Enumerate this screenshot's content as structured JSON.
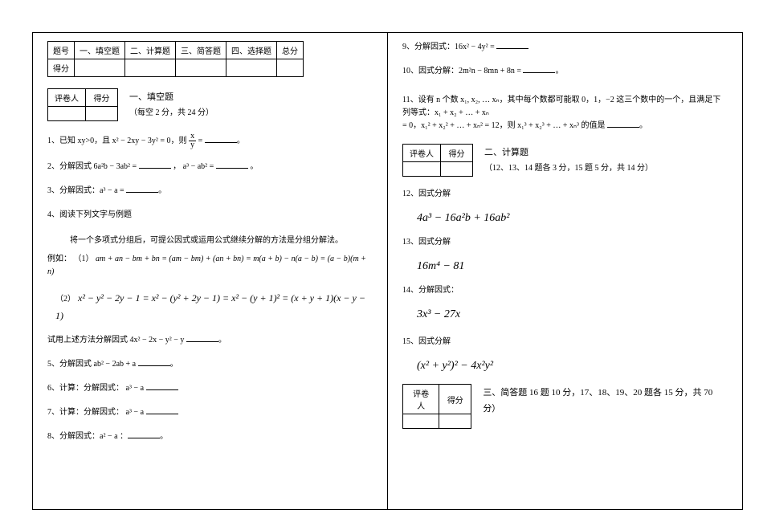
{
  "scoring": {
    "header": [
      "题号",
      "一、填空题",
      "二、计算题",
      "三、简答题",
      "四、选择题",
      "总分"
    ],
    "row_label": "得分",
    "mini_headers": [
      "评卷人",
      "得分"
    ]
  },
  "sections": {
    "fill": {
      "title": "一、填空题",
      "sub": "（每空 2 分，共 24 分）"
    },
    "calc": {
      "title": "二、计算题",
      "sub": "（12、13、14 题各 3 分，15 题 5 分，共 14 分）"
    },
    "ans": {
      "title": "三、简答题 16 题 10 分，17、18、19、20 题各 15 分，共 70 分）"
    }
  },
  "q1": {
    "pre": "1、已知 xy>0，且 x² − 2xy − 3y² = 0，则 ",
    "frac_top": "x",
    "frac_bot": "y",
    "post": " = "
  },
  "q2": {
    "pre": "2、分解因式 6a²b − 3ab² = ",
    "mid": "，  a³ − ab² = ",
    "post": "。"
  },
  "q3": "3、分解因式：a³ − a = ",
  "q4": {
    "title": "4、阅读下列文字与例题",
    "l1": "将一个多项式分组后，可提公因式或运用公式继续分解的方法是分组分解法。",
    "ex_label": "例如：",
    "ex1_pre": "（1）",
    "ex1": "am + an − bm + bn = (am − bm) + (an + bn) = m(a + b) − n(a − b) = (a − b)(m + n)",
    "ex2_pre": "（2）",
    "ex2": "x² − y² − 2y − 1 = x² − (y² + 2y − 1) = x² − (y + 1)² = (x + y + 1)(x − y − 1)",
    "try": "试用上述方法分解因式 4x² − 2x − y² − y "
  },
  "q5": "5、分解因式 ab² − 2ab + a ",
  "q6": "6、计算：分解因式：  a³ − a ",
  "q7": "7、计算：分解因式：  a³ − a ",
  "q8": "8、分解因式：a² − a ：",
  "q9": "9、分解因式：16x² − 4y² = ",
  "q10": "10、因式分解：2m²n − 8mn + 8n = ",
  "q11": {
    "l1": "11、设有 n 个数 x₁, x₂, … xₙ，其中每个数都可能取 0，1，−2 这三个数中的一个，且满足下列等式：x₁ + x₂ + … + xₙ",
    "l2": "= 0，x₁² + x₂² + … + xₙ² = 12，则 x₁³ + x₂³ + … + xₙ³ 的值是 "
  },
  "q12": {
    "label": "12、因式分解",
    "expr": "4a³ − 16a²b + 16ab²"
  },
  "q13": {
    "label": "13、因式分解",
    "expr": "16m⁴ − 81"
  },
  "q14": {
    "label": "14、分解因式：",
    "expr": "3x³ − 27x"
  },
  "q15": {
    "label": "15、因式分解",
    "expr": "(x² + y²)² − 4x²y²"
  }
}
